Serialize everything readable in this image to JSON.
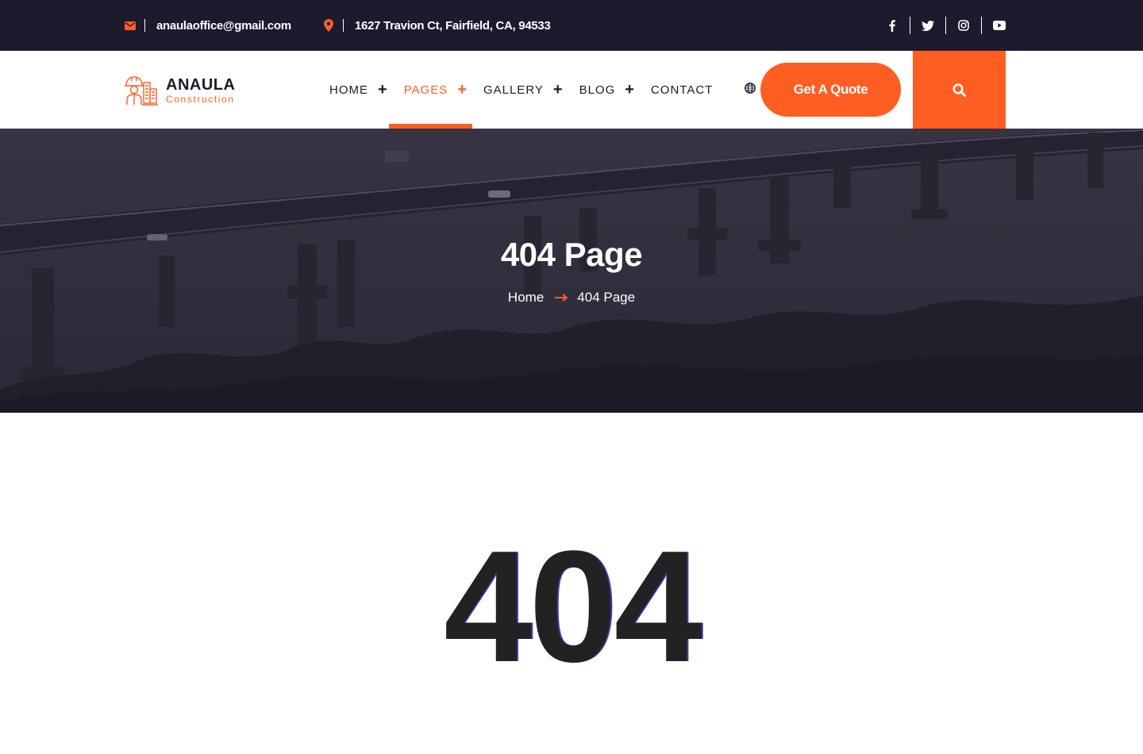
{
  "topbar": {
    "email": "anaulaoffice@gmail.com",
    "address": "1627 Travion Ct, Fairfield, CA, 94533",
    "icons": {
      "email": "envelope-icon",
      "address": "map-pin-icon"
    },
    "socials": [
      "facebook-icon",
      "twitter-icon",
      "instagram-icon",
      "youtube-icon"
    ]
  },
  "logo": {
    "name": "ANAULA",
    "tagline": "Construction"
  },
  "nav": {
    "items": [
      {
        "label": "HOME",
        "has_submenu": true
      },
      {
        "label": "PAGES",
        "has_submenu": true,
        "active": true
      },
      {
        "label": "GALLERY",
        "has_submenu": true
      },
      {
        "label": "BLOG",
        "has_submenu": true
      },
      {
        "label": "CONTACT",
        "has_submenu": false
      }
    ],
    "language_icon": "globe-icon",
    "quote_button": "Get A Quote",
    "search_icon": "search-icon"
  },
  "hero": {
    "title": "404 Page",
    "breadcrumb": {
      "home": "Home",
      "current": "404 Page"
    }
  },
  "error": {
    "code": "404"
  },
  "colors": {
    "accent": "#ff5e23",
    "dark": "#1e1a2e",
    "text": "#222222"
  }
}
